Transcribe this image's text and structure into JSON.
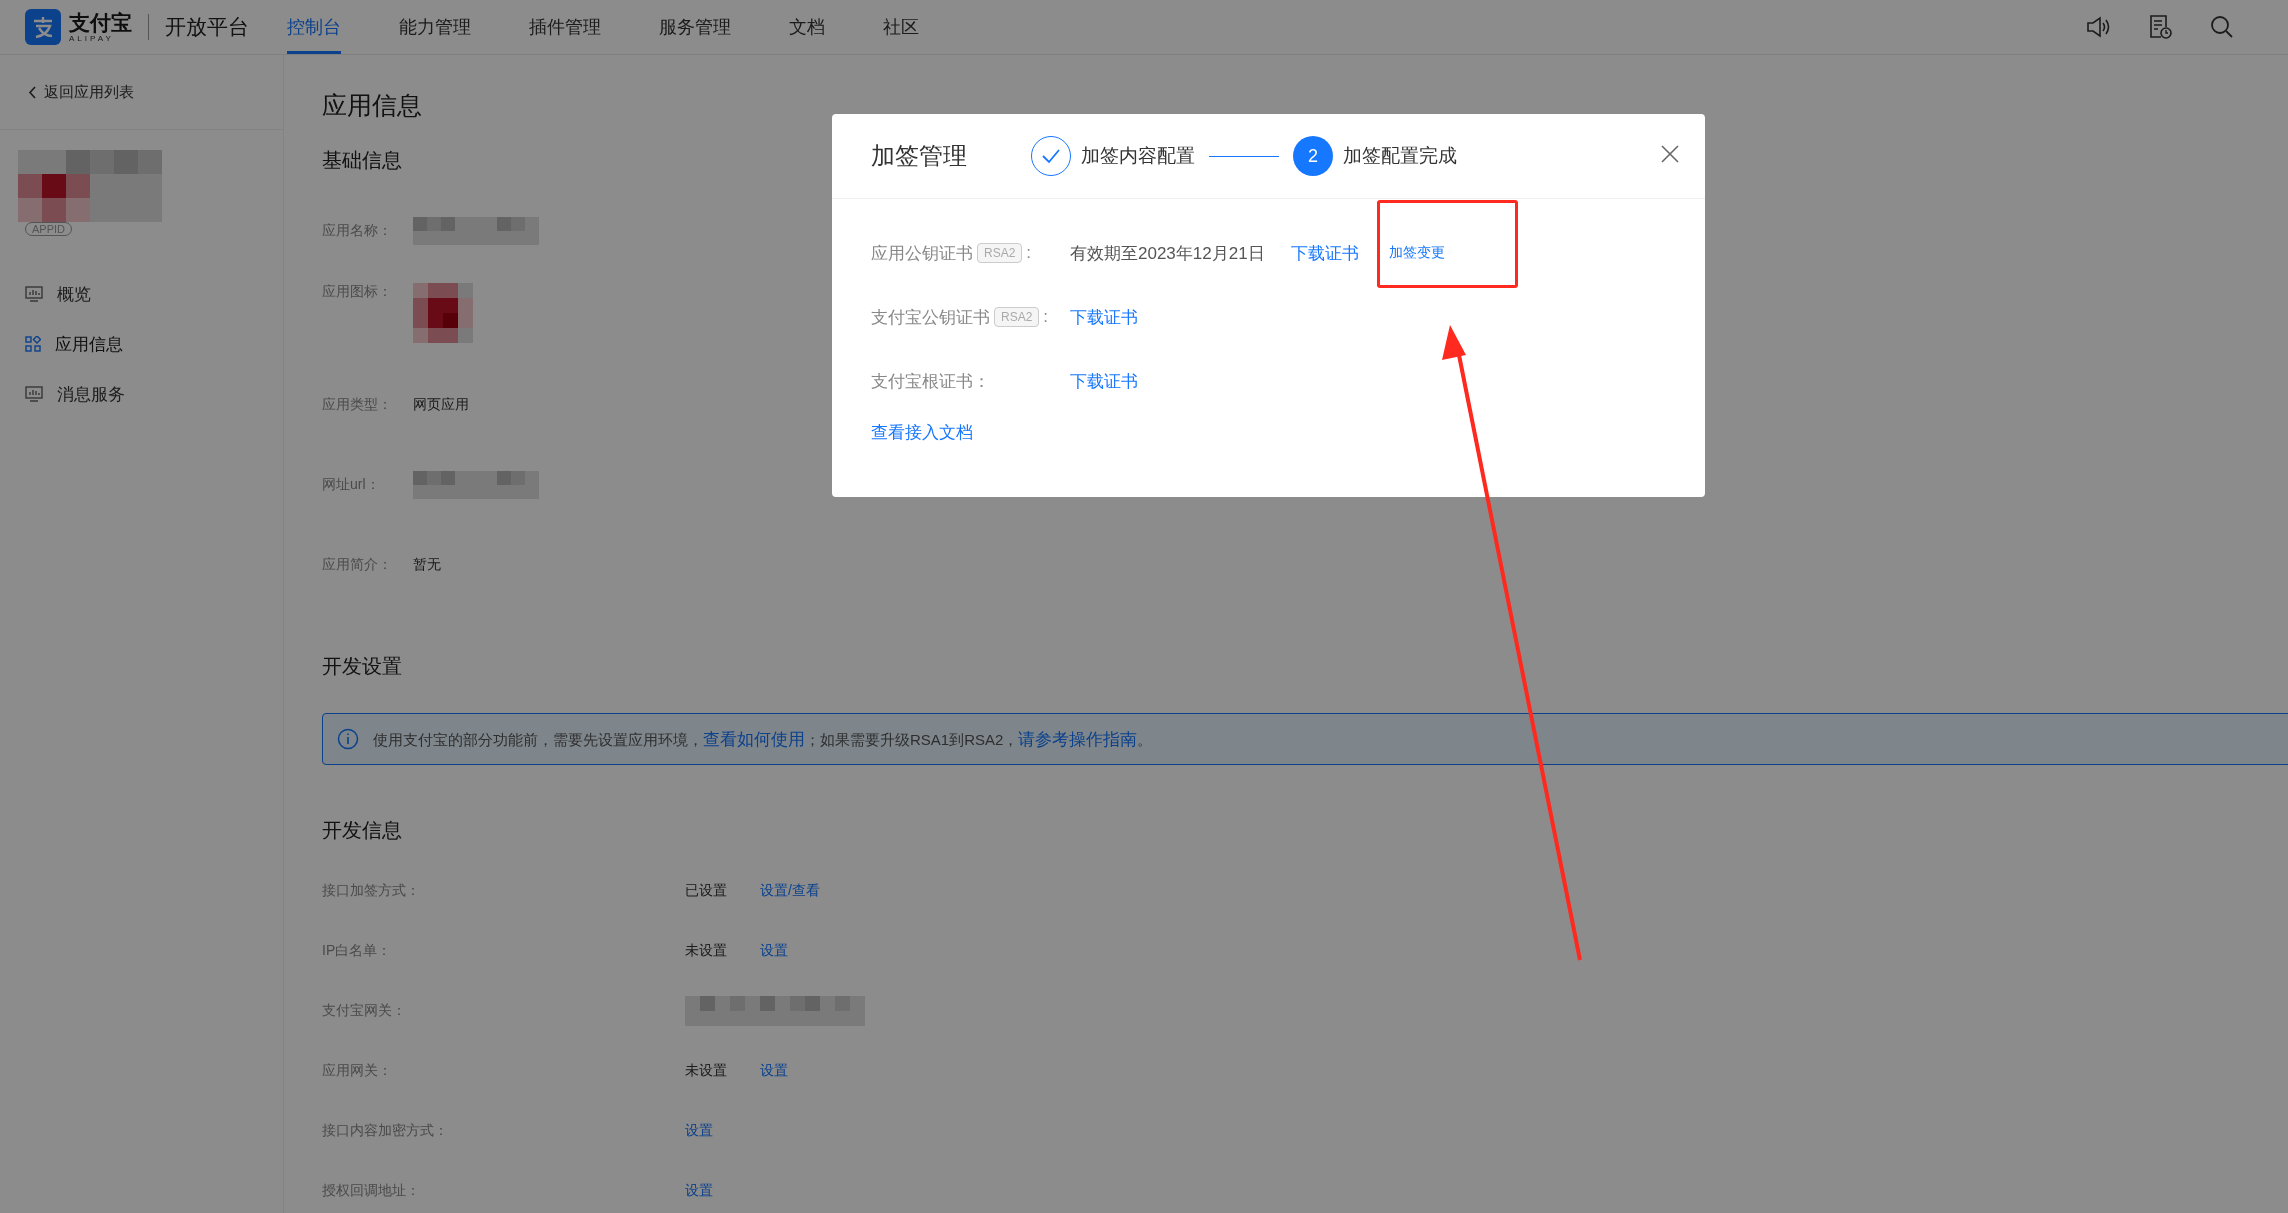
{
  "header": {
    "logo": {
      "brand": "支付宝",
      "sub": "ALIPAY",
      "platform": "开放平台"
    },
    "nav": [
      {
        "label": "控制台",
        "selected": true
      },
      {
        "label": "能力管理",
        "selected": false
      },
      {
        "label": "插件管理",
        "selected": false
      },
      {
        "label": "服务管理",
        "selected": false
      },
      {
        "label": "文档",
        "selected": false
      },
      {
        "label": "社区",
        "selected": false
      }
    ],
    "tools": [
      {
        "kind": "speaker"
      },
      {
        "kind": "notice"
      },
      {
        "kind": "search"
      }
    ]
  },
  "sidebar": {
    "back": "返回应用列表",
    "app_badge": "APPID",
    "menu": [
      {
        "label": "概览",
        "kind": "monitor",
        "selected": false
      },
      {
        "label": "应用信息",
        "kind": "grid",
        "selected": true
      },
      {
        "label": "消息服务",
        "kind": "monitor",
        "selected": false
      }
    ]
  },
  "main": {
    "title": "应用信息",
    "basic_info": {
      "title": "基础信息",
      "rows": [
        {
          "label": "应用名称：",
          "kind": "redacted"
        },
        {
          "label": "应用图标：",
          "kind": "icon"
        },
        {
          "label": "应用类型：",
          "kind": "text",
          "value": "网页应用"
        },
        {
          "label": "网址url：",
          "kind": "redacted"
        },
        {
          "label": "应用简介：",
          "kind": "text",
          "value": "暂无"
        }
      ]
    },
    "dev_settings": {
      "title": "开发设置",
      "banner": [
        {
          "text": "使用支付宝的部分功能前，需要先设置应用环境，",
          "link": false
        },
        {
          "text": "查看如何使用",
          "link": true
        },
        {
          "text": "；如果需要升级RSA1到RSA2，",
          "link": false
        },
        {
          "text": "请参考操作指南",
          "link": true
        },
        {
          "text": "。",
          "link": false
        }
      ]
    },
    "dev_info": {
      "title": "开发信息",
      "rows": [
        {
          "label": "接口加签方式：",
          "kind": "text",
          "status": "已设置",
          "action": "设置/查看"
        },
        {
          "label": "IP白名单：",
          "kind": "text",
          "status": "未设置",
          "action": "设置"
        },
        {
          "label": "支付宝网关：",
          "kind": "redacted"
        },
        {
          "label": "应用网关：",
          "kind": "text",
          "status": "未设置",
          "action": "设置"
        },
        {
          "label": "接口内容加密方式：",
          "kind": "text",
          "action": "设置"
        },
        {
          "label": "授权回调地址：",
          "kind": "text",
          "action": "设置"
        }
      ]
    }
  },
  "modal": {
    "title": "加签管理",
    "steps": [
      {
        "label": "加签内容配置",
        "done": true
      },
      {
        "label": "加签配置完成",
        "number": "2",
        "done": false
      }
    ],
    "rows": [
      {
        "label": "应用公钥证书",
        "tag": "RSA2",
        "suffix": ":",
        "value": "有效期至2023年12月21日",
        "links": [
          {
            "label": "下载证书",
            "kind": "primary"
          },
          {
            "label": "加签变更",
            "kind": "minor"
          }
        ]
      },
      {
        "label": "支付宝公钥证书",
        "tag": "RSA2",
        "suffix": ":",
        "links": [
          {
            "label": "下载证书",
            "kind": "primary"
          }
        ]
      },
      {
        "label": "支付宝根证书：",
        "links": [
          {
            "label": "下载证书",
            "kind": "primary"
          }
        ]
      }
    ],
    "doc_link": "查看接入文档"
  },
  "annotation": {
    "kind": "box-with-arrow"
  }
}
